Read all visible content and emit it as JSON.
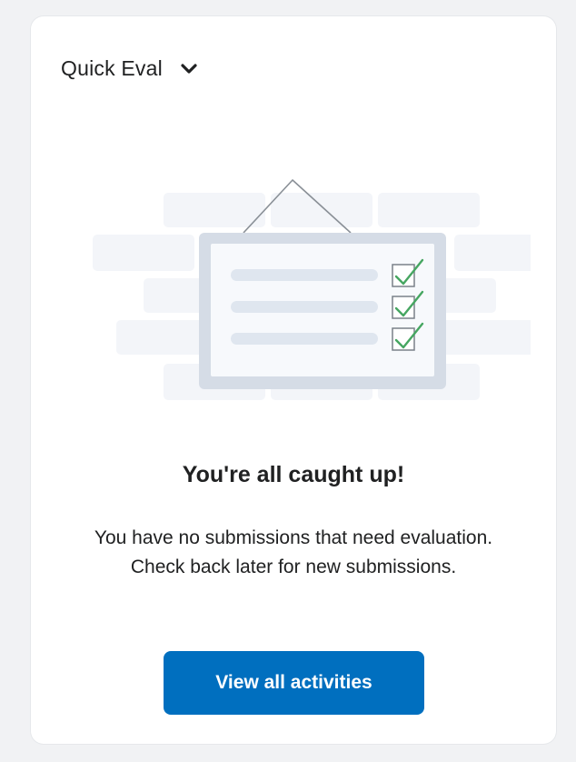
{
  "widget": {
    "title": "Quick Eval",
    "toggle_icon": "chevron-down-icon"
  },
  "empty_state": {
    "illustration_icon": "hanging-checklist-board-icon",
    "heading": "You're all caught up!",
    "message": "You have no submissions that need evaluation. Check back later for new submissions.",
    "button_label": "View all activities"
  },
  "colors": {
    "button_bg": "#006fbf",
    "check_green": "#46a661",
    "board_frame": "#d5dce6",
    "board_line": "#dfe6ef",
    "brick": "#f3f5f9"
  }
}
